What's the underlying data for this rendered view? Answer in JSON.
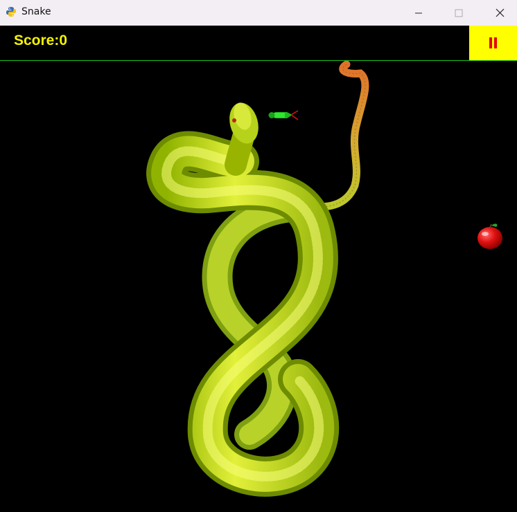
{
  "window": {
    "title": "Snake",
    "app_icon": "python-icon"
  },
  "header": {
    "score_text": "Score:0",
    "pause_icon": "pause-icon"
  },
  "game": {
    "food": "apple",
    "player": "green-snake-head",
    "background_art": "coiled-green-snake"
  },
  "colors": {
    "header_text": "#f4f400",
    "pause_bg": "#ffff00",
    "pause_icon": "#e60000",
    "divider": "#19c319",
    "background": "#000000"
  }
}
